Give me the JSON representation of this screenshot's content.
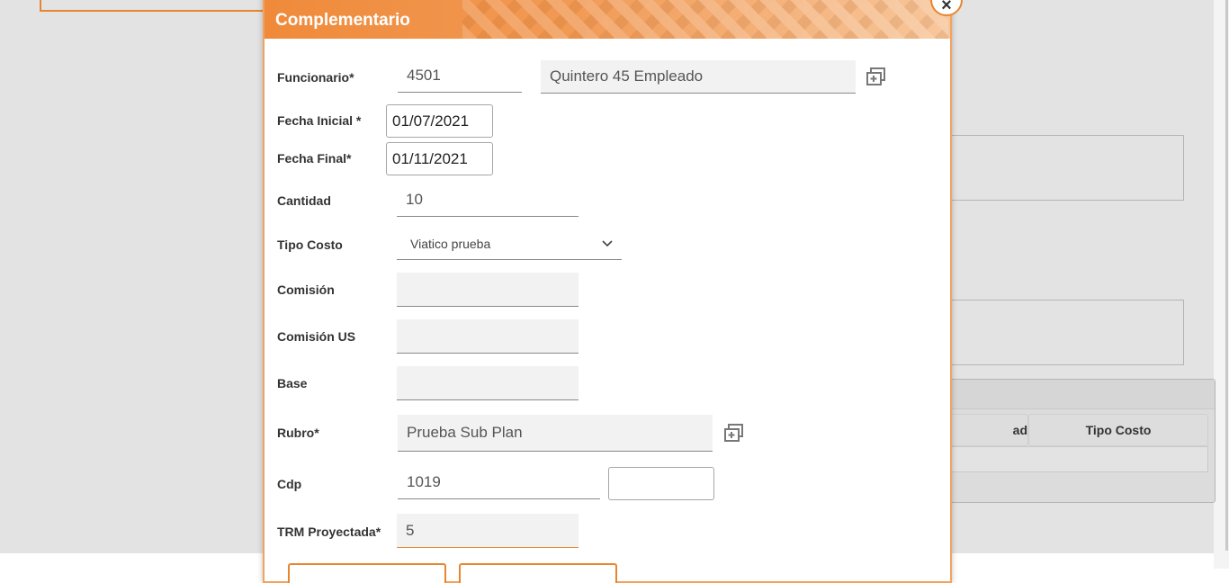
{
  "dialog": {
    "title": "Complementario",
    "close_label": "×"
  },
  "form": {
    "funcionario": {
      "label": "Funcionario*",
      "code": "4501",
      "name": "Quintero 45 Empleado"
    },
    "fecha_inicial": {
      "label": "Fecha Inicial *",
      "value": "01/07/2021"
    },
    "fecha_final": {
      "label": "Fecha Final*",
      "value": "01/11/2021"
    },
    "cantidad": {
      "label": "Cantidad",
      "value": "10"
    },
    "tipo_costo": {
      "label": "Tipo Costo",
      "value": "Viatico prueba"
    },
    "comision": {
      "label": "Comisión",
      "value": ""
    },
    "comision_us": {
      "label": "Comisión US",
      "value": ""
    },
    "base": {
      "label": "Base",
      "value": ""
    },
    "rubro": {
      "label": "Rubro*",
      "value": "Prueba Sub Plan"
    },
    "cdp": {
      "label": "Cdp",
      "value": "1019",
      "extra": ""
    },
    "trm": {
      "label": "TRM Proyectada*",
      "value": "5"
    }
  },
  "background_grid": {
    "columns": [
      "ad",
      "Tipo Costo"
    ]
  },
  "colors": {
    "accent": "#e8862f",
    "title_text": "#ffffff"
  },
  "icons": {
    "lookup": "copy-icon",
    "close": "close-icon",
    "dropdown": "chevron-down-icon"
  }
}
